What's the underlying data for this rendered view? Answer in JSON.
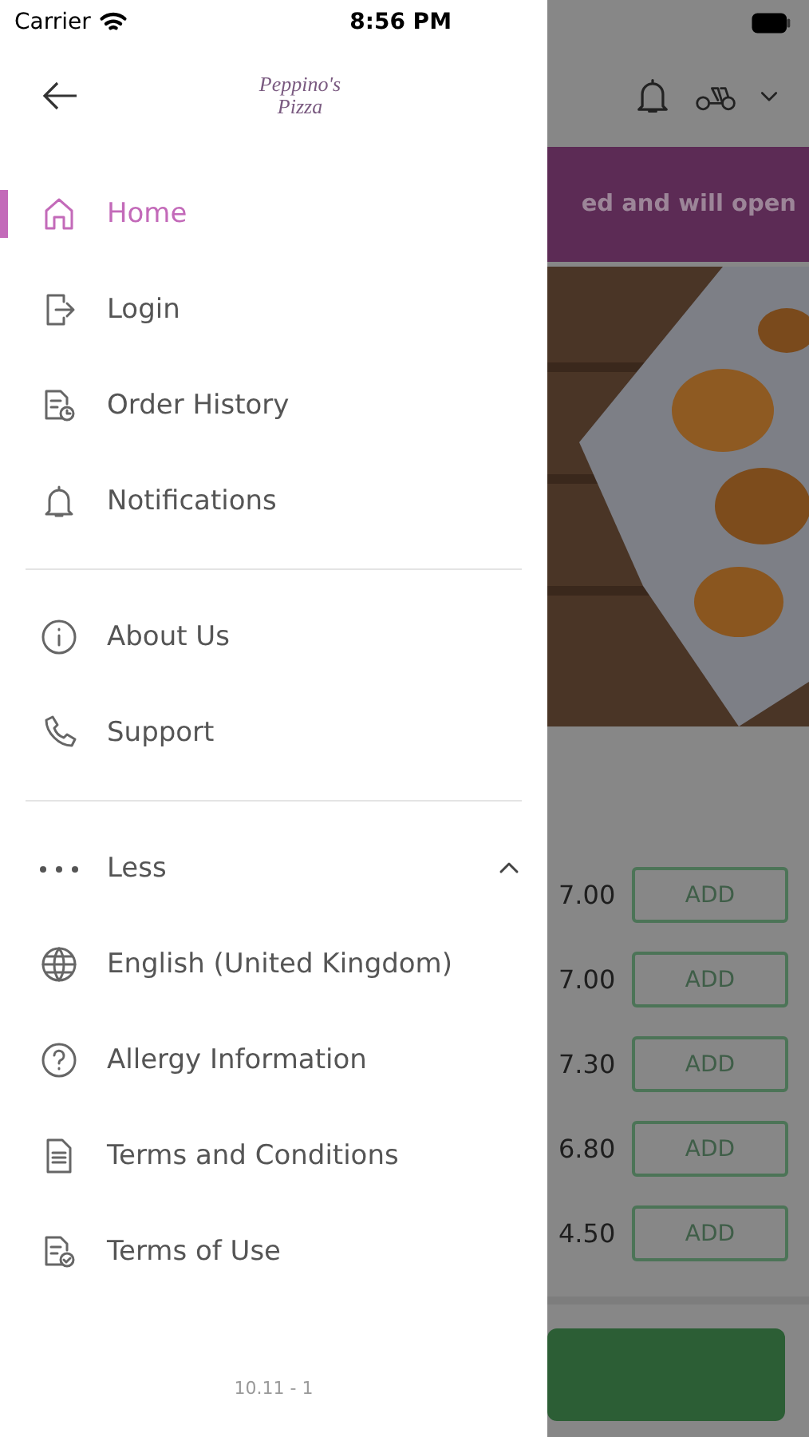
{
  "status_bar": {
    "carrier": "Carrier",
    "time": "8:56 PM"
  },
  "drawer": {
    "logo": "Peppino's Pizza",
    "sections": [
      {
        "items": [
          {
            "label": "Home",
            "kind": "home",
            "selected": true
          },
          {
            "label": "Login",
            "kind": "login",
            "selected": false
          },
          {
            "label": "Order History",
            "kind": "history",
            "selected": false
          },
          {
            "label": "Notifications",
            "kind": "bell",
            "selected": false
          }
        ]
      },
      {
        "items": [
          {
            "label": "About Us",
            "kind": "info",
            "selected": false
          },
          {
            "label": "Support",
            "kind": "phone",
            "selected": false
          }
        ]
      },
      {
        "toggle": {
          "label": "Less",
          "expanded": true
        },
        "items": [
          {
            "label": "English (United Kingdom)",
            "kind": "globe",
            "selected": false
          },
          {
            "label": "Allergy Information",
            "kind": "question",
            "selected": false
          },
          {
            "label": "Terms and Conditions",
            "kind": "doc",
            "selected": false
          },
          {
            "label": "Terms of Use",
            "kind": "doccheck",
            "selected": false
          }
        ]
      }
    ],
    "version": "10.11 - 1"
  },
  "background": {
    "banner": "ed and will open",
    "products": [
      {
        "price": "7.00",
        "button": "ADD"
      },
      {
        "price": "7.00",
        "button": "ADD"
      },
      {
        "price": "7.30",
        "button": "ADD"
      },
      {
        "price": "6.80",
        "button": "ADD"
      },
      {
        "price": "4.50",
        "button": "ADD"
      }
    ]
  }
}
